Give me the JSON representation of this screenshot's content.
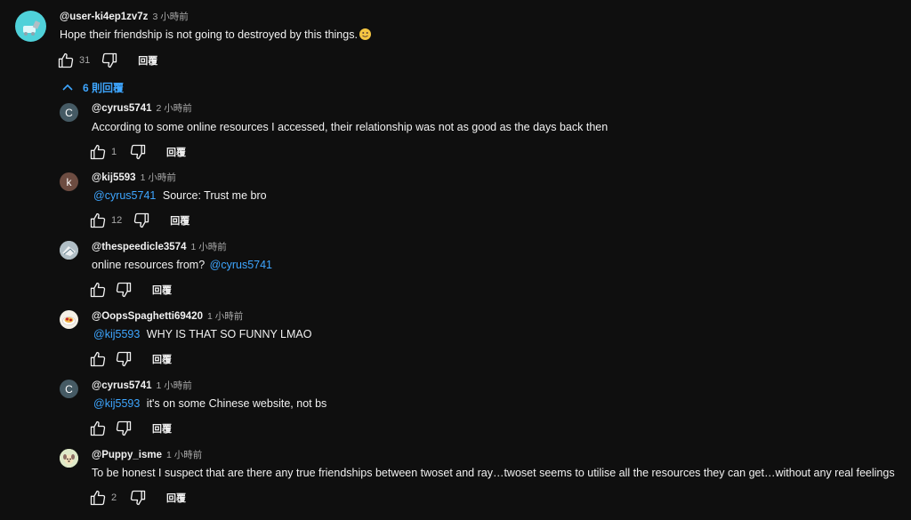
{
  "top_comment": {
    "handle": "@user-ki4ep1zv7z",
    "time": "3 小時前",
    "text": "Hope their friendship is not going to destroyed by this things.",
    "emoji": "smiling-face-emoji",
    "likes": "31",
    "reply_label": "回覆",
    "avatar_color": "#4fd1d9"
  },
  "replies_toggle": {
    "label": "6 則回覆",
    "color": "#3ea6ff"
  },
  "replies": [
    {
      "handle": "@cyrus5741",
      "time": "2 小時前",
      "mention": "",
      "text": "According to some online resources I accessed, their relationship was not as good as the days back then",
      "likes": "1",
      "reply_label": "回覆",
      "avatar_letter": "C",
      "avatar_color": "#455a64"
    },
    {
      "handle": "@kij5593",
      "time": "1 小時前",
      "mention": "@cyrus5741",
      "text": "Source: Trust me bro",
      "likes": "12",
      "reply_label": "回覆",
      "avatar_letter": "k",
      "avatar_color": "#6d4c41"
    },
    {
      "handle": "@thespeedicle3574",
      "time": "1 小時前",
      "text": "online resources from?",
      "trailing_mention": "@cyrus5741",
      "likes": "",
      "reply_label": "回覆",
      "avatar_color": "#9e9e9e"
    },
    {
      "handle": "@OopsSpaghetti69420",
      "time": "1 小時前",
      "mention": "@kij5593",
      "text": "WHY IS THAT SO FUNNY LMAO",
      "likes": "",
      "reply_label": "回覆",
      "avatar_color": "#f5f0e6"
    },
    {
      "handle": "@cyrus5741",
      "time": "1 小時前",
      "mention": "@kij5593",
      "text": "it's on some Chinese website, not bs",
      "likes": "",
      "reply_label": "回覆",
      "avatar_letter": "C",
      "avatar_color": "#455a64"
    },
    {
      "handle": "@Puppy_isme",
      "time": "1 小時前",
      "mention": "",
      "text": "To be honest I suspect that are there any true friendships between twoset and ray…twoset seems to utilise all the resources they can get…without any real feelings",
      "likes": "2",
      "reply_label": "回覆",
      "avatar_color": "#c5d9a8"
    }
  ]
}
